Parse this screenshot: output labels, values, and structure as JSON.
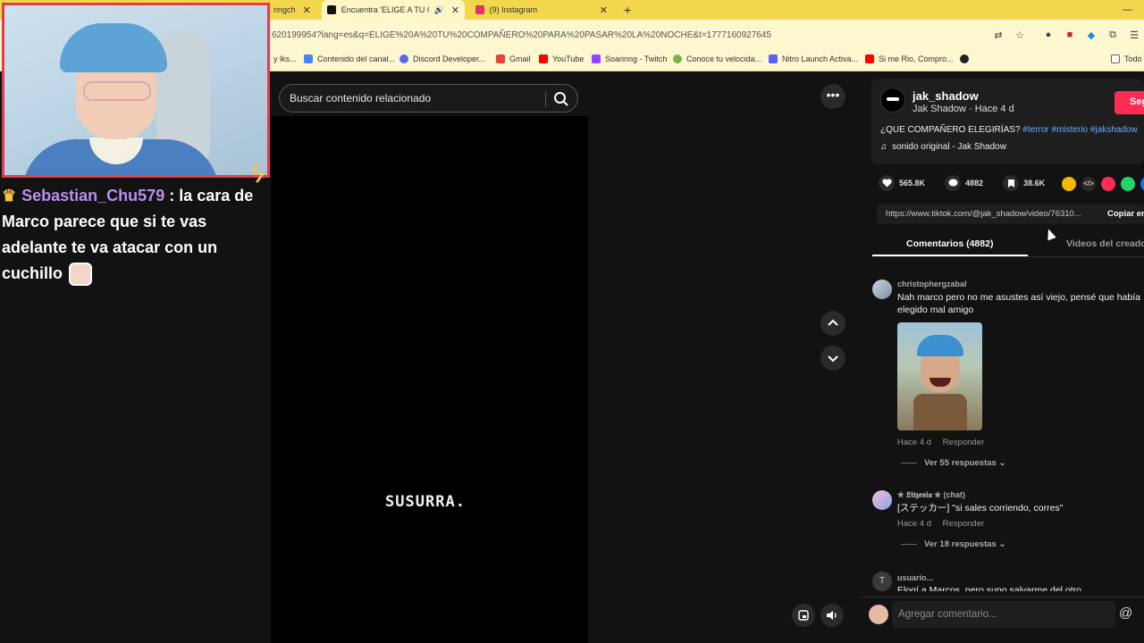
{
  "browser": {
    "tabs": [
      {
        "label": "ringch",
        "active": false
      },
      {
        "label": "Encuentra 'ELIGE A TU COM",
        "active": true
      },
      {
        "label": "(9) Instagram",
        "active": false
      }
    ],
    "new_tab": "+",
    "url": "620199954?lang=es&q=ELIGE%20A%20TU%20COMPAÑERO%20PARA%20PASAR%20LA%20NOCHE&t=1777160927645",
    "bookmarks": [
      {
        "label": "y lks...",
        "color": "#999999"
      },
      {
        "label": "Contenido del canal...",
        "color": "#4285f4"
      },
      {
        "label": "Discord Developer...",
        "color": "#5865f2"
      },
      {
        "label": "Gmail",
        "color": "#ea4335"
      },
      {
        "label": "YouTube",
        "color": "#ff0000"
      },
      {
        "label": "Soarinng - Twitch",
        "color": "#9146ff"
      },
      {
        "label": "Conoce tu velocida...",
        "color": "#7cb342"
      },
      {
        "label": "Nitro Launch Activa...",
        "color": "#5865f2"
      },
      {
        "label": "Si me Rio, Compro...",
        "color": "#ff0000"
      },
      {
        "label": "Todo",
        "color": "#666666"
      }
    ]
  },
  "stream_chat": {
    "username": "Sebastian_Chu579",
    "message": ": la cara de Marco parece que si te vas adelante te va atacar con un cuchillo"
  },
  "video": {
    "search_placeholder": "Buscar contenido relacionado",
    "overlay_text": "SUSURRA.",
    "more_label": "•••"
  },
  "creator": {
    "username": "jak_shadow",
    "subtitle": "Jak Shadow · Hace 4 d",
    "follow_label": "Seg",
    "description_text": "¿QUE COMPAÑERO ELEGIRÍAS?",
    "hashtags": [
      "#terror",
      "#misterio",
      "#jakshadow"
    ],
    "sound": "sonido original - Jak Shadow"
  },
  "stats": {
    "likes": "565.8K",
    "comments": "4882",
    "saves": "38.6K"
  },
  "share": {
    "link": "https://www.tiktok.com/@jak_shadow/video/76310...",
    "copy_label": "Copiar en"
  },
  "panel_tabs": {
    "comments": "Comentarios (4882)",
    "creator_videos": "Videos del creador"
  },
  "comments": [
    {
      "user": "christophergzabal",
      "text": "Nah marco pero no me asustes así viejo, pensé que había elegido mal amigo",
      "time": "Hace 4 d",
      "reply": "Responder",
      "replies": "Ver 55 respuestas"
    },
    {
      "user": "✯ 𝕷𝖎𝖙𝖟𝖊𝖓𝖎𝖆 ✯ (chat)",
      "text": "[ステッカー] \"si sales corriendo, corres\"",
      "time": "Hace 4 d",
      "reply": "Responder",
      "replies": "Ver 18 respuestas"
    },
    {
      "user": "usuario...",
      "text": "Elogí a Marcos, pero supo salvarme del otro"
    }
  ],
  "compose": {
    "placeholder": "Agregar comentario...",
    "at": "@"
  }
}
